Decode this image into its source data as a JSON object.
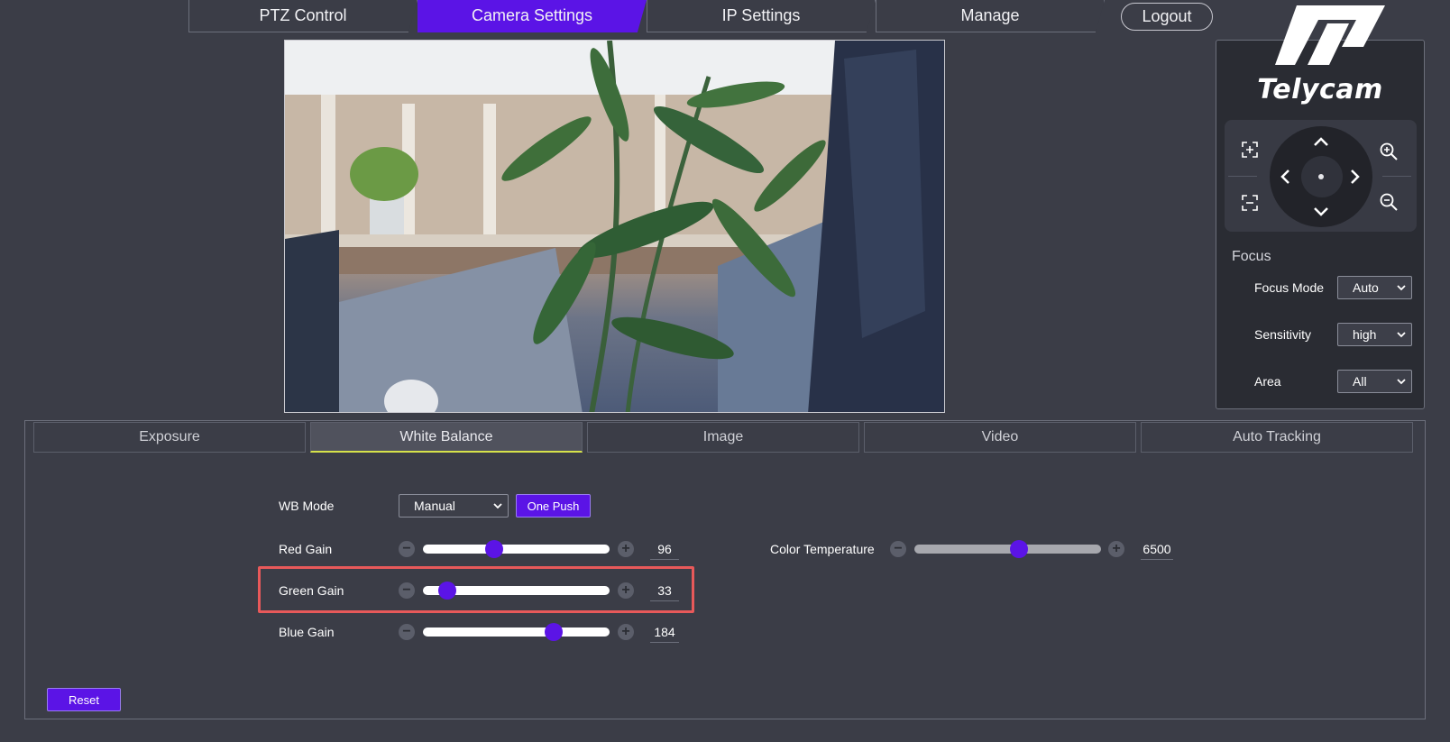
{
  "nav": {
    "tabs": [
      {
        "label": "PTZ Control",
        "active": false
      },
      {
        "label": "Camera Settings",
        "active": true
      },
      {
        "label": "IP Settings",
        "active": false
      },
      {
        "label": "Manage",
        "active": false
      }
    ],
    "logout": "Logout"
  },
  "brand": {
    "name": "Telycam"
  },
  "focus": {
    "title": "Focus",
    "rows": [
      {
        "label": "Focus Mode",
        "value": "Auto"
      },
      {
        "label": "Sensitivity",
        "value": "high"
      },
      {
        "label": "Area",
        "value": "All"
      }
    ]
  },
  "settings": {
    "tabs": [
      {
        "label": "Exposure",
        "active": false
      },
      {
        "label": "White Balance",
        "active": true
      },
      {
        "label": "Image",
        "active": false
      },
      {
        "label": "Video",
        "active": false
      },
      {
        "label": "Auto Tracking",
        "active": false
      }
    ],
    "wb_mode": {
      "label": "WB Mode",
      "value": "Manual",
      "one_push": "One Push"
    },
    "red_gain": {
      "label": "Red Gain",
      "value": "96",
      "fraction": 0.38
    },
    "green_gain": {
      "label": "Green Gain",
      "value": "33",
      "fraction": 0.13
    },
    "blue_gain": {
      "label": "Blue Gain",
      "value": "184",
      "fraction": 0.7
    },
    "color_temperature": {
      "label": "Color Temperature",
      "value": "6500",
      "fraction": 0.56
    },
    "reset": "Reset"
  },
  "colors": {
    "accent": "#5b14e6",
    "highlight": "#e8595a",
    "background": "#3b3d47"
  }
}
